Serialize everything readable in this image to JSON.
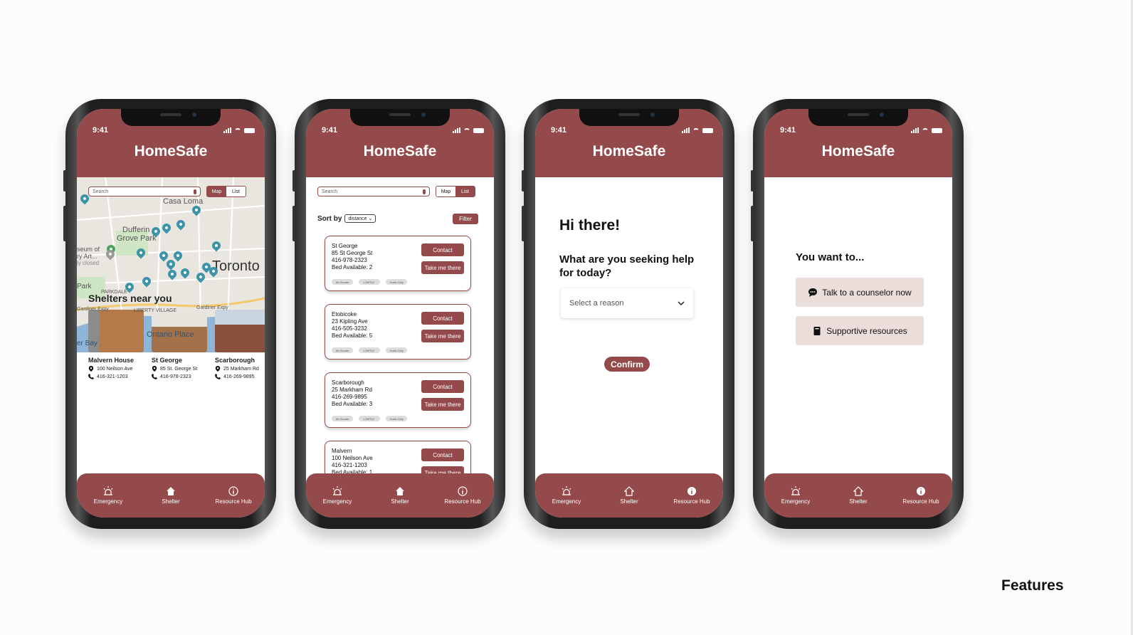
{
  "status_time": "9:41",
  "app_title": "HomeSafe",
  "tabs": {
    "emergency": "Emergency",
    "shelter": "Shelter",
    "resource": "Resource Hub"
  },
  "search": {
    "placeholder": "Search"
  },
  "view_toggle": {
    "map": "Map",
    "list": "List"
  },
  "map_labels": {
    "casa_loma": "Casa Loma",
    "dufferin": "Dufferin",
    "grove_park": "Grove Park",
    "museum1": "seum of",
    "museum2": "ry Art...",
    "museum3": "ly closed",
    "toronto": "Toronto",
    "park": "Park",
    "parkdale": "PARKDALE",
    "gardiner1": "Gardiner Expy",
    "liberty": "LIBERTY VILLAGE",
    "gardiner2": "Gardiner Expy",
    "ontario": "Ontario Place",
    "bay": "er Bay"
  },
  "shelters_near": {
    "heading": "Shelters near you",
    "items": [
      {
        "name": "Malvern House",
        "address": "100 Neilson Ave",
        "phone": "416-321-1203"
      },
      {
        "name": "St George",
        "address": "85 St. George St",
        "phone": "416-978-2323"
      },
      {
        "name": "Scarborough",
        "address": "25 Markham Rd",
        "phone": "416-269-9895"
      }
    ]
  },
  "list_screen": {
    "sort_label": "Sort by",
    "sort_value": "distance",
    "filter": "Filter",
    "contact": "Contact",
    "take_me": "Take me there",
    "tag_labels": [
      "All Gender",
      "LGBTQ+",
      "Youth-Only"
    ],
    "shelters": [
      {
        "name": "St George",
        "address": "85 St George St",
        "phone": "416-978-2323",
        "beds": "Bed Available: 2"
      },
      {
        "name": "Etobicoke",
        "address": "23 Kipling Ave",
        "phone": "416-505-3232",
        "beds": "Bed Available: 5"
      },
      {
        "name": "Scarborough",
        "address": "25 Markham Rd",
        "phone": "416-269-9895",
        "beds": "Bed Available: 3"
      },
      {
        "name": "Malvern",
        "address": "100 Neilson Ave",
        "phone": "416-321-1203",
        "beds": "Bed Available: 1"
      }
    ]
  },
  "help_screen": {
    "greeting": "Hi there!",
    "question": "What are you seeking help for today?",
    "select_placeholder": "Select a reason",
    "confirm": "Confirm"
  },
  "resource_screen": {
    "heading": "You want to...",
    "option_counselor": "Talk to a counselor now",
    "option_resources": "Supportive resources"
  },
  "page_label": "Features",
  "colors": {
    "brand": "#944a4a",
    "pin": "#3d93a8",
    "option_bg": "#eaddda"
  }
}
